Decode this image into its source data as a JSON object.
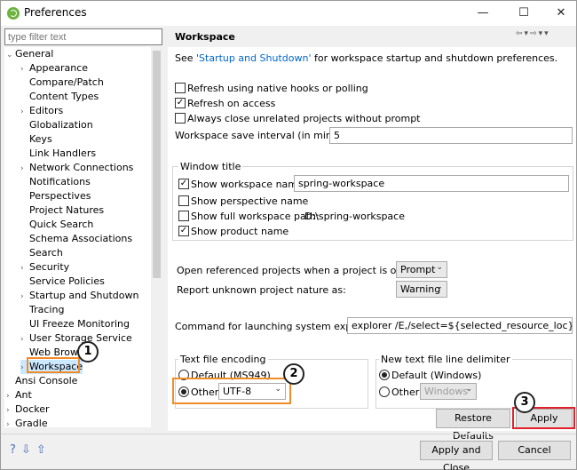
{
  "window": {
    "title": "Preferences",
    "minimize": "—",
    "maximize": "☐",
    "close": "✕"
  },
  "filter": {
    "placeholder": "type filter text"
  },
  "tree": [
    {
      "label": "General",
      "expanded": true
    },
    {
      "label": "Appearance",
      "expander": true
    },
    {
      "label": "Compare/Patch"
    },
    {
      "label": "Content Types"
    },
    {
      "label": "Editors",
      "expander": true
    },
    {
      "label": "Globalization"
    },
    {
      "label": "Keys"
    },
    {
      "label": "Link Handlers"
    },
    {
      "label": "Network Connections",
      "expander": true
    },
    {
      "label": "Notifications"
    },
    {
      "label": "Perspectives"
    },
    {
      "label": "Project Natures"
    },
    {
      "label": "Quick Search"
    },
    {
      "label": "Schema Associations"
    },
    {
      "label": "Search"
    },
    {
      "label": "Security",
      "expander": true
    },
    {
      "label": "Service Policies"
    },
    {
      "label": "Startup and Shutdown",
      "expander": true
    },
    {
      "label": "Tracing"
    },
    {
      "label": "UI Freeze Monitoring"
    },
    {
      "label": "User Storage Service",
      "expander": true
    },
    {
      "label": "Web Brow"
    },
    {
      "label": "Workspace",
      "expander": true,
      "selected": true
    },
    {
      "label": "Ansi Console"
    },
    {
      "label": "Ant",
      "expander": true
    },
    {
      "label": "Docker",
      "expander": true
    },
    {
      "label": "Gradle",
      "expander": true
    }
  ],
  "page": {
    "title": "Workspace",
    "see_prefix": "See ",
    "see_link": "'Startup and Shutdown'",
    "see_suffix": " for workspace startup and shutdown preferences.",
    "refresh_native": {
      "label": "Refresh using native hooks or polling",
      "checked": false
    },
    "refresh_access": {
      "label": "Refresh on access",
      "checked": true
    },
    "close_unrelated": {
      "label": "Always close unrelated projects without prompt",
      "checked": false
    },
    "save_interval": {
      "label": "Workspace save interval (in minutes):",
      "value": "5"
    },
    "window_title": {
      "group_label": "Window title",
      "show_name": {
        "label": "Show workspace name:",
        "checked": true,
        "value": "spring-workspace"
      },
      "show_perspective": {
        "label": "Show perspective name",
        "checked": false
      },
      "show_full_path": {
        "label": "Show full workspace path:",
        "checked": false,
        "path": "D:\\spring-workspace"
      },
      "show_product": {
        "label": "Show product name",
        "checked": true
      }
    },
    "open_referenced": {
      "label": "Open referenced projects when a project is opened:",
      "value": "Prompt"
    },
    "report_nature": {
      "label": "Report unknown project nature as:",
      "value": "Warning"
    },
    "explorer_command": {
      "label": "Command for launching system explorer:",
      "value": "explorer /E,/select=${selected_resource_loc}"
    },
    "encoding": {
      "group_label": "Text file encoding",
      "default_label": "Default (MS949)",
      "other_label": "Other:",
      "other_value": "UTF-8",
      "selected": "other"
    },
    "line_delimiter": {
      "group_label": "New text file line delimiter",
      "default_label": "Default (Windows)",
      "other_label": "Other:",
      "other_value": "Windows",
      "selected": "default"
    },
    "restore_defaults": "Restore Defaults",
    "apply": "Apply"
  },
  "footer": {
    "apply_close": "Apply and Close",
    "cancel": "Cancel"
  },
  "badges": [
    "1",
    "2",
    "3"
  ],
  "colors": {
    "highlight_orange": "#f28c28",
    "highlight_red": "#e0202a",
    "link": "#0066cc"
  }
}
